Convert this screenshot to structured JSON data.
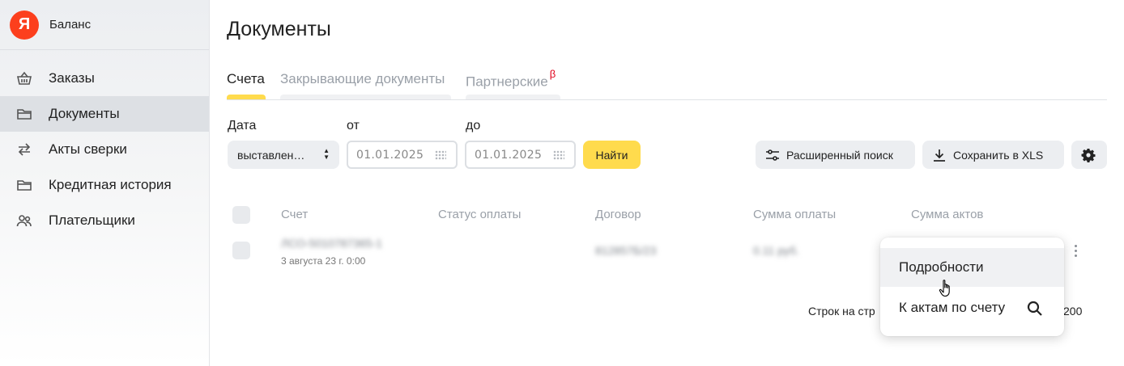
{
  "brand": {
    "logo_letter": "Я",
    "name": "Баланс",
    "logo_color": "#fc3f1d"
  },
  "sidebar": {
    "items": [
      {
        "label": "Заказы",
        "icon": "basket-icon"
      },
      {
        "label": "Документы",
        "icon": "folder-icon",
        "active": true
      },
      {
        "label": "Акты сверки",
        "icon": "swap-arrows-icon"
      },
      {
        "label": "Кредитная история",
        "icon": "folder-icon"
      },
      {
        "label": "Плательщики",
        "icon": "users-icon"
      }
    ]
  },
  "page": {
    "title": "Документы"
  },
  "tabs": [
    {
      "label": "Счета",
      "active": true
    },
    {
      "label": "Закрывающие документы"
    },
    {
      "label": "Партнерские",
      "badge": "β"
    }
  ],
  "filters": {
    "date_label": "Дата",
    "from_label": "от",
    "to_label": "до",
    "date_type_value": "выставлен…",
    "from_value": "01.01.2025",
    "to_value": "01.01.2025",
    "find_button": "Найти",
    "advanced_search": "Расширенный поиск",
    "save_xls": "Сохранить в XLS"
  },
  "table": {
    "columns": [
      "Счет",
      "Статус оплаты",
      "Договор",
      "Сумма оплаты",
      "Сумма актов"
    ],
    "rows": [
      {
        "invoice": "ЛСО-5010787365-1",
        "date": "3 августа 23 г. 0:00",
        "contract": "812857Б/23",
        "amount": "0.11 руб."
      }
    ]
  },
  "pagination": {
    "label": "Строк на стр",
    "value": "200"
  },
  "context_menu": {
    "items": [
      {
        "label": "Подробности"
      },
      {
        "label": "К актам по счету",
        "icon": "search-icon"
      }
    ]
  },
  "colors": {
    "accent": "#ffdb4d",
    "beta": "#e0001a"
  }
}
